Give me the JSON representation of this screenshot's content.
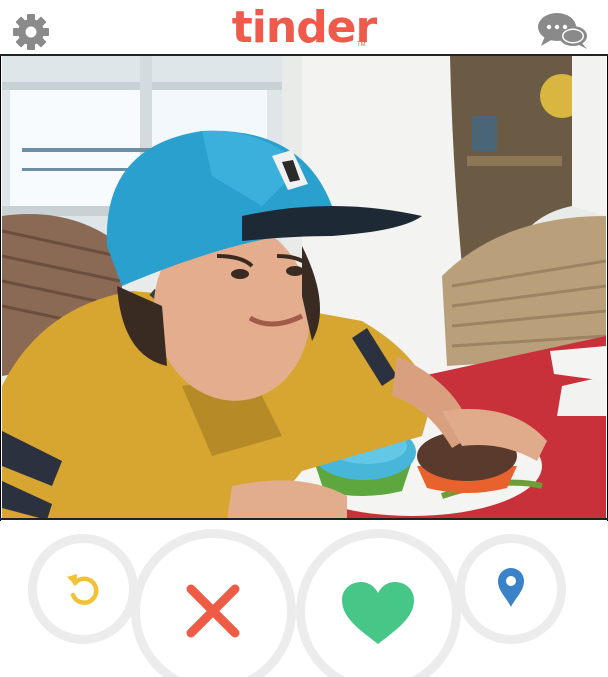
{
  "app": {
    "logo_text": "tinder",
    "logo_tm": "TM"
  },
  "header": {
    "settings_icon": "gear-icon",
    "messages_icon": "chat-bubbles-icon"
  },
  "actions": {
    "rewind_icon": "rewind-icon",
    "nope_icon": "x-icon",
    "like_icon": "heart-icon",
    "location_icon": "location-pin-icon"
  },
  "colors": {
    "brand": "#ef5a4a",
    "rewind": "#f2c235",
    "nope": "#ee5c45",
    "like": "#46c687",
    "location": "#3b83c9",
    "header_icons": "#8a8a8a"
  }
}
